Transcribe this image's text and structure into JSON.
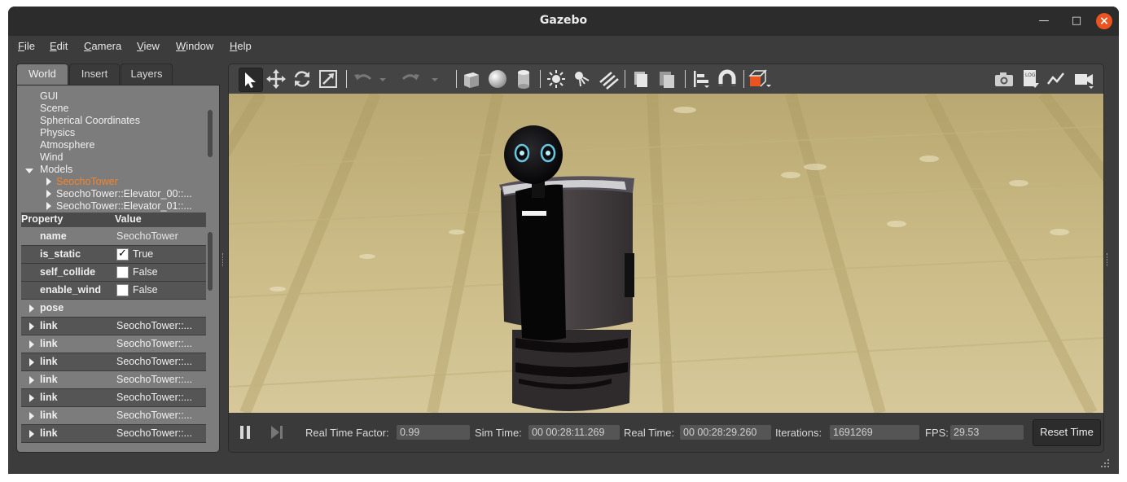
{
  "window": {
    "title": "Gazebo"
  },
  "menu": [
    {
      "u": "F",
      "rest": "ile"
    },
    {
      "u": "E",
      "rest": "dit"
    },
    {
      "u": "C",
      "rest": "amera"
    },
    {
      "u": "V",
      "rest": "iew"
    },
    {
      "u": "W",
      "rest": "indow"
    },
    {
      "u": "H",
      "rest": "elp"
    }
  ],
  "tabs": [
    "World",
    "Insert",
    "Layers"
  ],
  "tree": {
    "items": [
      "GUI",
      "Scene",
      "Spherical Coordinates",
      "Physics",
      "Atmosphere",
      "Wind"
    ],
    "models_label": "Models",
    "selected_model": "SeochoTower",
    "children": [
      "SeochoTower::Elevator_00::...",
      "SeochoTower::Elevator_01::..."
    ]
  },
  "properties": {
    "header": {
      "property": "Property",
      "value": "Value"
    },
    "name": {
      "key": "name",
      "value": "SeochoTower"
    },
    "is_static": {
      "key": "is_static",
      "checked": true,
      "label": "True"
    },
    "self_collide": {
      "key": "self_collide",
      "checked": false,
      "label": "False"
    },
    "enable_wind": {
      "key": "enable_wind",
      "checked": false,
      "label": "False"
    },
    "pose": {
      "key": "pose"
    },
    "links": [
      {
        "key": "link",
        "value": "SeochoTower::..."
      },
      {
        "key": "link",
        "value": "SeochoTower::..."
      },
      {
        "key": "link",
        "value": "SeochoTower::..."
      },
      {
        "key": "link",
        "value": "SeochoTower::..."
      },
      {
        "key": "link",
        "value": "SeochoTower::..."
      },
      {
        "key": "link",
        "value": "SeochoTower::..."
      },
      {
        "key": "link",
        "value": "SeochoTower::..."
      }
    ]
  },
  "stats": {
    "rtf_label": "Real Time Factor:",
    "rtf": "0.99",
    "sim_label": "Sim Time:",
    "sim": "00 00:28:11.269",
    "real_label": "Real Time:",
    "real": "00 00:28:29.260",
    "iter_label": "Iterations:",
    "iter": "1691269",
    "fps_label": "FPS:",
    "fps": "29.53",
    "reset_label": "Reset Time"
  },
  "colors": {
    "accent": "#e95420",
    "selected_text": "#f5842a",
    "floor": "#b7a46a"
  }
}
